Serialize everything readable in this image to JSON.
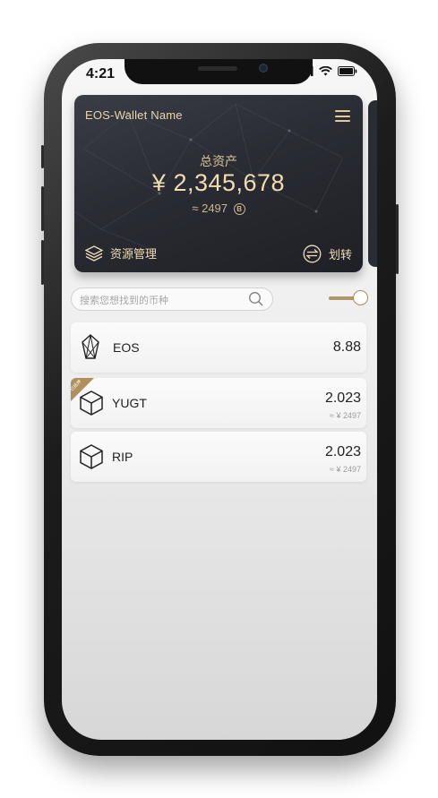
{
  "status_bar": {
    "time": "4:21"
  },
  "wallet_card": {
    "name": "EOS-Wallet Name",
    "total_label": "总资产",
    "total_value": "¥ 2,345,678",
    "approx_prefix": "≈ 2497",
    "btc_symbol": "B",
    "actions": {
      "resource_label": "资源管理",
      "transfer_label": "划转"
    }
  },
  "search": {
    "placeholder": "搜索您想找到的币种"
  },
  "toggle": {
    "on": true
  },
  "assets": [
    {
      "name": "EOS",
      "amount": "8.88",
      "fiat": "",
      "icon": "eos-logo-icon"
    },
    {
      "name": "YUGT",
      "amount": "2.023",
      "fiat": "≈ ¥ 2497",
      "icon": "cube-icon",
      "badge": "已抵押"
    },
    {
      "name": "RIP",
      "amount": "2.023",
      "fiat": "≈ ¥ 2497",
      "icon": "cube-icon"
    }
  ],
  "colors": {
    "gold": "#e4c99c",
    "card_dark": "#2a2c33",
    "ribbon": "#b0905a"
  }
}
